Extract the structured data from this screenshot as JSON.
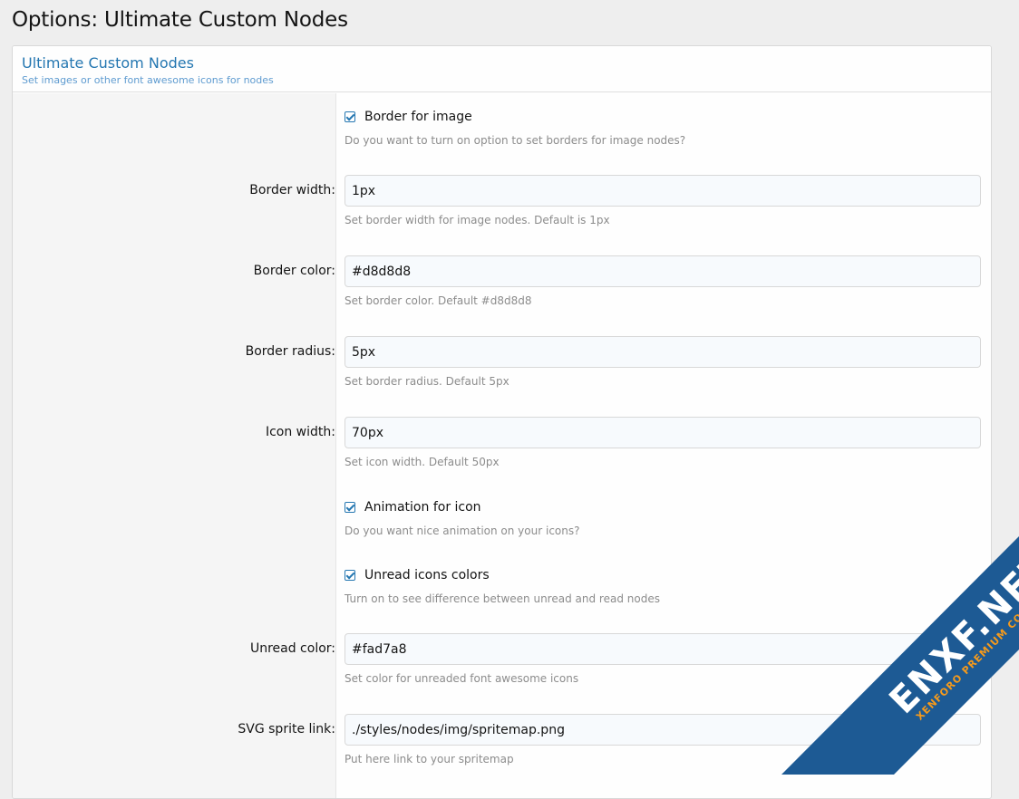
{
  "page": {
    "title": "Options: Ultimate Custom Nodes"
  },
  "block": {
    "title": "Ultimate Custom Nodes",
    "description": "Set images or other font awesome icons for nodes"
  },
  "options": {
    "border_for_image": {
      "label": "Border for image",
      "checked": true,
      "hint": "Do you want to turn on option to set borders for image nodes?"
    },
    "border_width": {
      "label": "Border width:",
      "value": "1px",
      "hint": "Set border width for image nodes. Default is 1px"
    },
    "border_color": {
      "label": "Border color:",
      "value": "#d8d8d8",
      "hint": "Set border color. Default #d8d8d8"
    },
    "border_radius": {
      "label": "Border radius:",
      "value": "5px",
      "hint": "Set border radius. Default 5px"
    },
    "icon_width": {
      "label": "Icon width:",
      "value": "70px",
      "hint": "Set icon width. Default 50px"
    },
    "animation_for_icon": {
      "label": "Animation for icon",
      "checked": true,
      "hint": "Do you want nice animation on your icons?"
    },
    "unread_icons_colors": {
      "label": "Unread icons colors",
      "checked": true,
      "hint": "Turn on to see difference between unread and read nodes"
    },
    "unread_color": {
      "label": "Unread color:",
      "value": "#fad7a8",
      "hint": "Set color for unreaded font awesome icons"
    },
    "svg_sprite_link": {
      "label": "SVG sprite link:",
      "value": "./styles/nodes/img/spritemap.png",
      "hint": "Put here link to your spritemap"
    }
  },
  "watermark": {
    "text": "ENXF.NET",
    "subtext": "XENFORO PREMIUM COMMUNITY",
    "color": "#1d5a94"
  },
  "colors": {
    "accent": "#2577b1",
    "hint": "#8c8c8c",
    "input_bg": "#f7fafd"
  }
}
